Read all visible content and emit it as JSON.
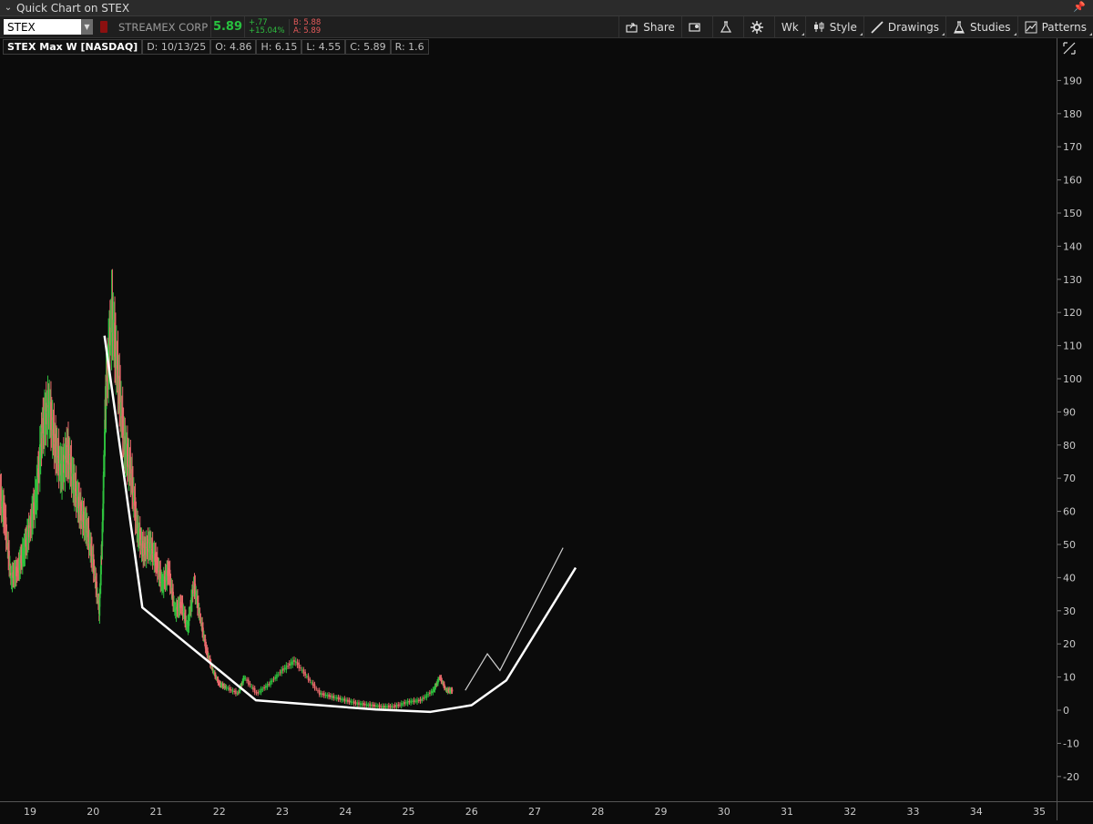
{
  "window": {
    "title": "Quick Chart on STEX"
  },
  "toolbar": {
    "symbol": "STEX",
    "company": "STREAMEX CORP",
    "last": "5.89",
    "change": "+.77",
    "change_pct": "+15.04%",
    "bid": "B: 5.88",
    "ask": "A: 5.89",
    "buttons": [
      "Share",
      "Wk",
      "Style",
      "Drawings",
      "Studies",
      "Patterns"
    ]
  },
  "info": {
    "name": "STEX Max W [NASDAQ]",
    "date": "D: 10/13/25",
    "open": "O: 4.86",
    "high": "H: 6.15",
    "low": "L: 4.55",
    "close": "C: 5.89",
    "range": "R: 1.6"
  },
  "colors": {
    "up": "#2fc23e",
    "down": "#e8696b",
    "background": "#0b0b0b",
    "grid_label": "#c8c8c8",
    "drawing": "#ffffff"
  },
  "chart_data": {
    "type": "line",
    "y_ticks": [
      190,
      180,
      170,
      160,
      150,
      140,
      130,
      120,
      110,
      100,
      90,
      80,
      70,
      60,
      50,
      40,
      30,
      20,
      10,
      0,
      -10,
      -20
    ],
    "x_ticks": [
      "19",
      "20",
      "21",
      "22",
      "23",
      "24",
      "25",
      "26",
      "27",
      "28",
      "29",
      "30",
      "31",
      "32",
      "33",
      "34",
      "35"
    ],
    "ylim": [
      -25,
      200
    ],
    "xlim": [
      18.5,
      35.4
    ],
    "grid": false,
    "series": [
      {
        "values": [
          [
            18.5,
            68
          ],
          [
            18.6,
            58
          ],
          [
            18.7,
            40
          ],
          [
            18.8,
            42
          ],
          [
            18.9,
            48
          ],
          [
            19.0,
            55
          ],
          [
            19.1,
            65
          ],
          [
            19.2,
            85
          ],
          [
            19.3,
            92
          ],
          [
            19.4,
            80
          ],
          [
            19.5,
            72
          ],
          [
            19.6,
            78
          ],
          [
            19.7,
            68
          ],
          [
            19.8,
            60
          ],
          [
            19.9,
            55
          ],
          [
            20.0,
            45
          ],
          [
            20.1,
            30
          ],
          [
            20.15,
            55
          ],
          [
            20.2,
            95
          ],
          [
            20.3,
            120
          ],
          [
            20.4,
            100
          ],
          [
            20.5,
            80
          ],
          [
            20.6,
            72
          ],
          [
            20.7,
            55
          ],
          [
            20.8,
            48
          ],
          [
            20.9,
            50
          ],
          [
            21.0,
            45
          ],
          [
            21.1,
            38
          ],
          [
            21.2,
            42
          ],
          [
            21.3,
            30
          ],
          [
            21.4,
            32
          ],
          [
            21.5,
            25
          ],
          [
            21.6,
            38
          ],
          [
            21.7,
            28
          ],
          [
            21.8,
            18
          ],
          [
            21.9,
            12
          ],
          [
            22.0,
            8
          ],
          [
            22.1,
            7
          ],
          [
            22.3,
            5
          ],
          [
            22.4,
            10
          ],
          [
            22.6,
            5
          ],
          [
            22.8,
            8
          ],
          [
            23.0,
            12
          ],
          [
            23.2,
            15
          ],
          [
            23.4,
            10
          ],
          [
            23.6,
            5
          ],
          [
            23.8,
            4
          ],
          [
            24.0,
            3
          ],
          [
            24.2,
            2
          ],
          [
            24.4,
            1.5
          ],
          [
            24.6,
            1
          ],
          [
            24.8,
            1.2
          ],
          [
            25.0,
            2.5
          ],
          [
            25.2,
            3
          ],
          [
            25.4,
            6
          ],
          [
            25.5,
            10
          ],
          [
            25.6,
            6
          ],
          [
            25.7,
            5.89
          ]
        ]
      },
      {
        "values": [
          [
            20.18,
            113
          ],
          [
            20.78,
            31
          ],
          [
            22.58,
            3
          ],
          [
            24.48,
            0.2
          ],
          [
            25.35,
            -0.5
          ],
          [
            26.0,
            1.5
          ],
          [
            26.55,
            9
          ],
          [
            27.65,
            43
          ]
        ]
      },
      {
        "values": [
          [
            25.9,
            6
          ],
          [
            26.25,
            17
          ],
          [
            26.45,
            12
          ],
          [
            27.45,
            49
          ]
        ]
      }
    ]
  }
}
